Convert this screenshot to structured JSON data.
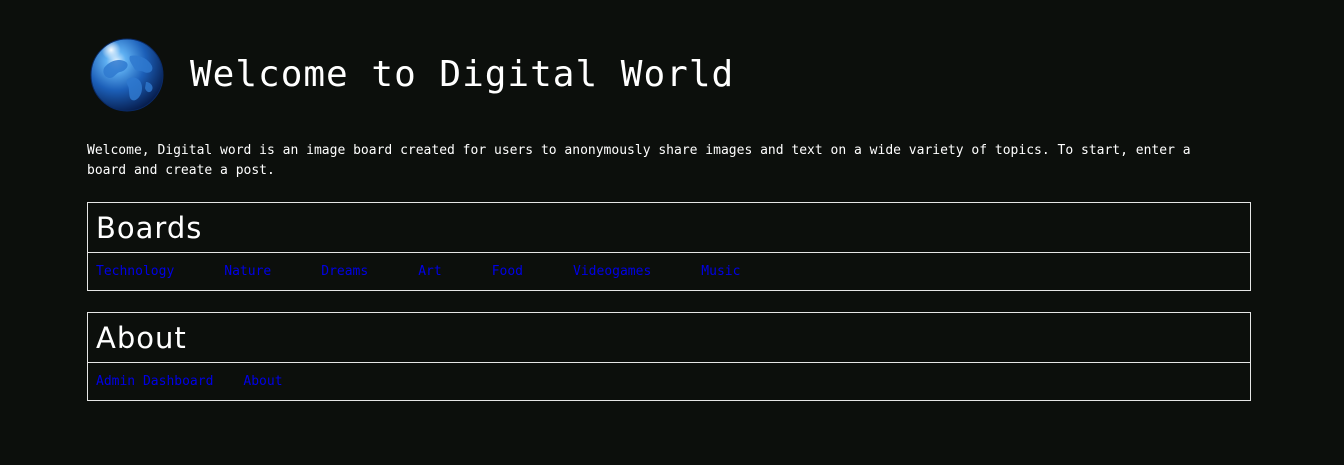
{
  "header": {
    "title": "Welcome to Digital World",
    "logo_icon": "globe-icon"
  },
  "intro": {
    "text": "Welcome, Digital word is an image board created for users to anonymously share images and text on a wide variety of topics. To start, enter a board and create a post."
  },
  "boards": {
    "heading": "Boards",
    "links": [
      {
        "label": "Technology"
      },
      {
        "label": "Nature"
      },
      {
        "label": "Dreams"
      },
      {
        "label": "Art"
      },
      {
        "label": "Food"
      },
      {
        "label": "Videogames"
      },
      {
        "label": "Music"
      }
    ]
  },
  "about": {
    "heading": "About",
    "links": [
      {
        "label": "Admin Dashboard"
      },
      {
        "label": "About"
      }
    ]
  },
  "colors": {
    "background": "#0c0f0c",
    "text": "#ffffff",
    "link": "#0000e6",
    "border": "#e6e6e6"
  }
}
